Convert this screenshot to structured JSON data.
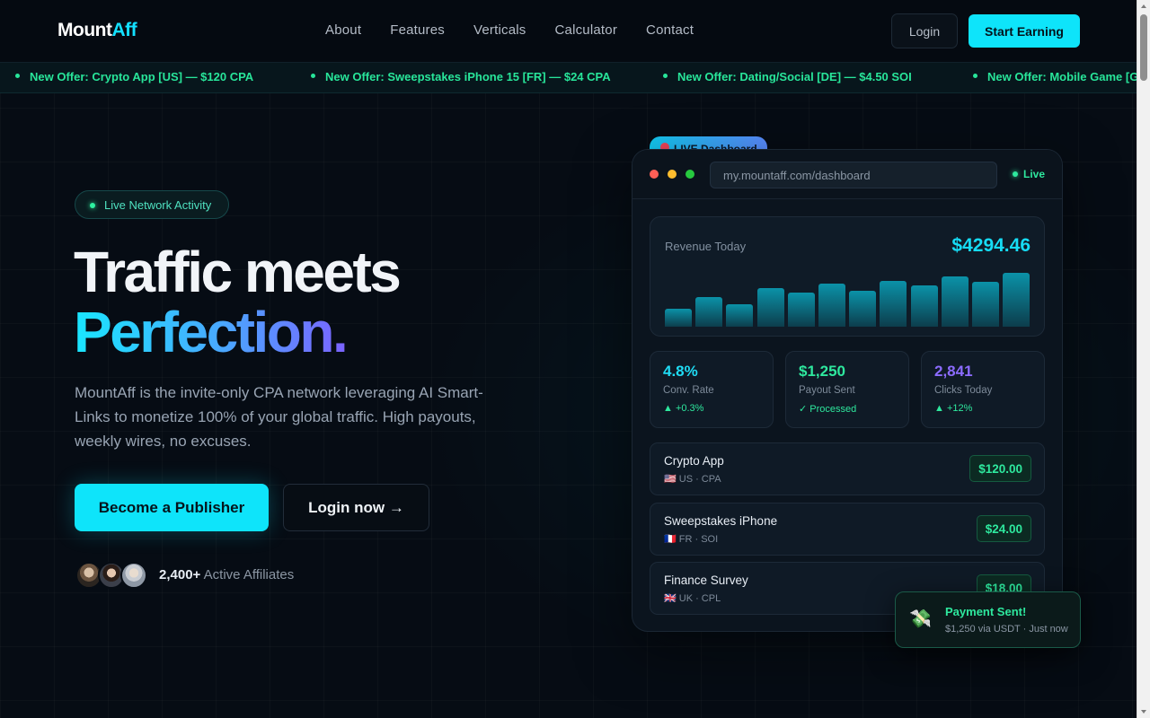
{
  "nav": {
    "logo_main": "Mount",
    "logo_accent": "Aff",
    "links": [
      "About",
      "Features",
      "Verticals",
      "Calculator",
      "Contact"
    ],
    "login": "Login",
    "start": "Start Earning"
  },
  "ticker": [
    "New Offer: Crypto App [US] — $120 CPA",
    "New Offer: Sweepstakes iPhone 15 [FR] — $24 CPA",
    "New Offer: Dating/Social [DE] — $4.50 SOI",
    "New Offer: Mobile Game [G"
  ],
  "hero": {
    "badge": "Live Network Activity",
    "title_line1": "Traffic meets",
    "title_line2": "Perfection.",
    "description": "MountAff is the invite-only CPA network leveraging AI Smart-Links to monetize 100% of your global traffic. High payouts, weekly wires, no excuses.",
    "cta_primary": "Become a Publisher",
    "cta_secondary": "Login now →",
    "affiliates_count": "2,400+",
    "affiliates_label": "Active Affiliates"
  },
  "dashboard": {
    "pill": "LIVE Dashboard",
    "url": "my.mountaff.com/dashboard",
    "live": "Live",
    "revenue_label": "Revenue Today",
    "revenue_value": "$4294.46",
    "revenue_bars": [
      0.31,
      0.5,
      0.39,
      0.66,
      0.58,
      0.74,
      0.62,
      0.79,
      0.71,
      0.86,
      0.77,
      0.93
    ],
    "stats": [
      {
        "value": "4.8%",
        "label": "Conv. Rate",
        "change": "▲ +0.3%",
        "color": "#1fdcf5"
      },
      {
        "value": "$1,250",
        "label": "Payout Sent",
        "change": "✓ Processed",
        "color": "#2ee89e"
      },
      {
        "value": "2,841",
        "label": "Clicks Today",
        "change": "▲ +12%",
        "color": "#8c6cff"
      }
    ],
    "offers": [
      {
        "name": "Crypto App",
        "meta": "🇺🇸 US · CPA",
        "payout": "$120.00"
      },
      {
        "name": "Sweepstakes iPhone",
        "meta": "🇫🇷 FR · SOI",
        "payout": "$24.00"
      },
      {
        "name": "Finance Survey",
        "meta": "🇬🇧 UK · CPL",
        "payout": "$18.00"
      }
    ]
  },
  "toast": {
    "icon": "💸",
    "title": "Payment Sent!",
    "subtitle": "$1,250 via USDT · Just now"
  },
  "colors": {
    "accent": "#0ee4fa",
    "success": "#2ee89e",
    "background": "#060c14"
  }
}
